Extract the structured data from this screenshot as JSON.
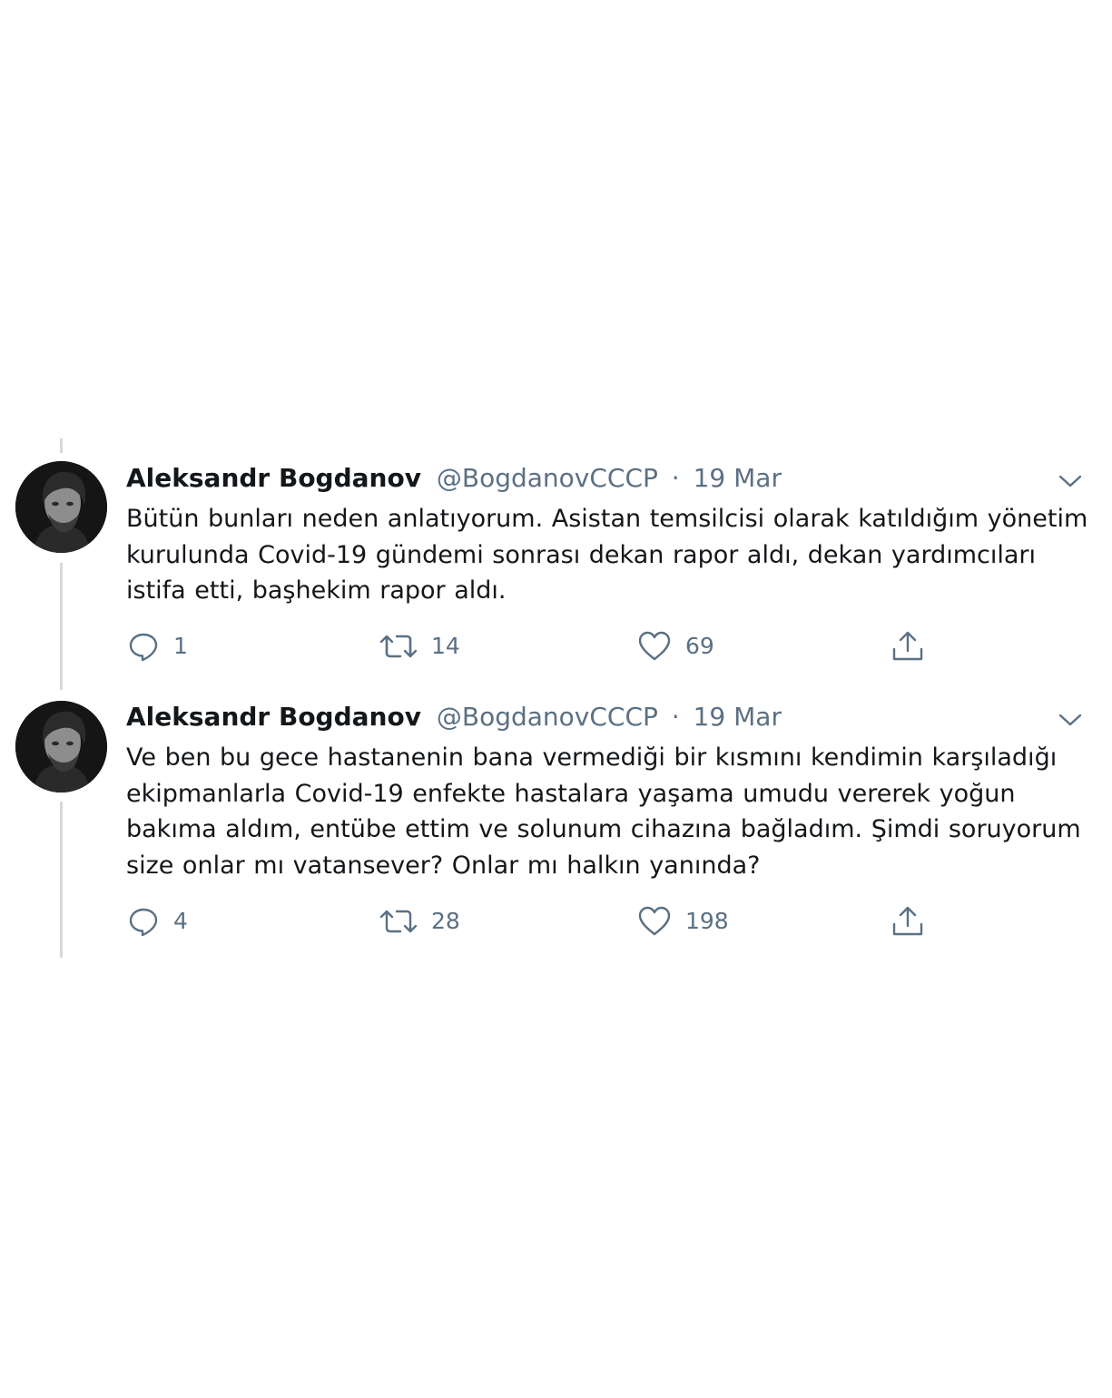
{
  "tweets": [
    {
      "author_name": "Aleksandr Bogdanov",
      "handle": "@BogdanovCCCP",
      "separator": "·",
      "date": "19 Mar",
      "text": "Bütün bunları neden anlatıyorum. Asistan temsilcisi olarak katıldığım yönetim kurulunda Covid-19 gündemi sonrası dekan rapor aldı, dekan yardımcıları istifa etti, başhekim rapor aldı.",
      "replies": "1",
      "retweets": "14",
      "likes": "69"
    },
    {
      "author_name": "Aleksandr Bogdanov",
      "handle": "@BogdanovCCCP",
      "separator": "·",
      "date": "19 Mar",
      "text": "Ve ben bu gece hastanenin bana vermediği bir kısmını kendimin karşıladığı ekipmanlarla Covid-19 enfekte hastalara yaşama umudu vererek yoğun bakıma aldım, entübe ettim ve solunum cihazına bağladım. Şimdi soruyorum size onlar mı vatansever? Onlar mı halkın yanında?",
      "replies": "4",
      "retweets": "28",
      "likes": "198"
    }
  ],
  "icons": {
    "reply": "reply-icon",
    "retweet": "retweet-icon",
    "like": "heart-icon",
    "share": "share-icon",
    "more": "chevron-down-icon"
  },
  "colors": {
    "text": "#14171a",
    "secondary": "#5b7083",
    "thread_line": "#d5d9dd",
    "background": "#ffffff"
  }
}
